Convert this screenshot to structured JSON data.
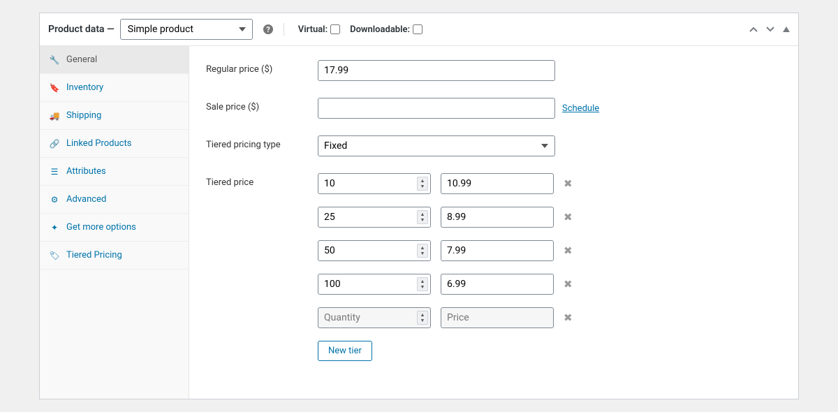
{
  "header": {
    "title": "Product data —",
    "product_type": "Simple product",
    "virtual_label": "Virtual:",
    "downloadable_label": "Downloadable:"
  },
  "sidebar": {
    "items": [
      {
        "label": "General",
        "icon": "wrench",
        "active": true
      },
      {
        "label": "Inventory",
        "icon": "tag",
        "active": false
      },
      {
        "label": "Shipping",
        "icon": "truck",
        "active": false
      },
      {
        "label": "Linked Products",
        "icon": "link",
        "active": false
      },
      {
        "label": "Attributes",
        "icon": "list",
        "active": false
      },
      {
        "label": "Advanced",
        "icon": "gear",
        "active": false
      },
      {
        "label": "Get more options",
        "icon": "bolt",
        "active": false
      },
      {
        "label": "Tiered Pricing",
        "icon": "pricetag",
        "active": false
      }
    ]
  },
  "fields": {
    "regular_price_label": "Regular price ($)",
    "regular_price_value": "17.99",
    "sale_price_label": "Sale price ($)",
    "sale_price_value": "",
    "schedule_link": "Schedule",
    "tiered_type_label": "Tiered pricing type",
    "tiered_type_value": "Fixed",
    "tiered_price_label": "Tiered price",
    "tiers": [
      {
        "qty": "10",
        "price": "10.99"
      },
      {
        "qty": "25",
        "price": "8.99"
      },
      {
        "qty": "50",
        "price": "7.99"
      },
      {
        "qty": "100",
        "price": "6.99"
      }
    ],
    "placeholder_qty": "Quantity",
    "placeholder_price": "Price",
    "new_tier_button": "New tier"
  }
}
